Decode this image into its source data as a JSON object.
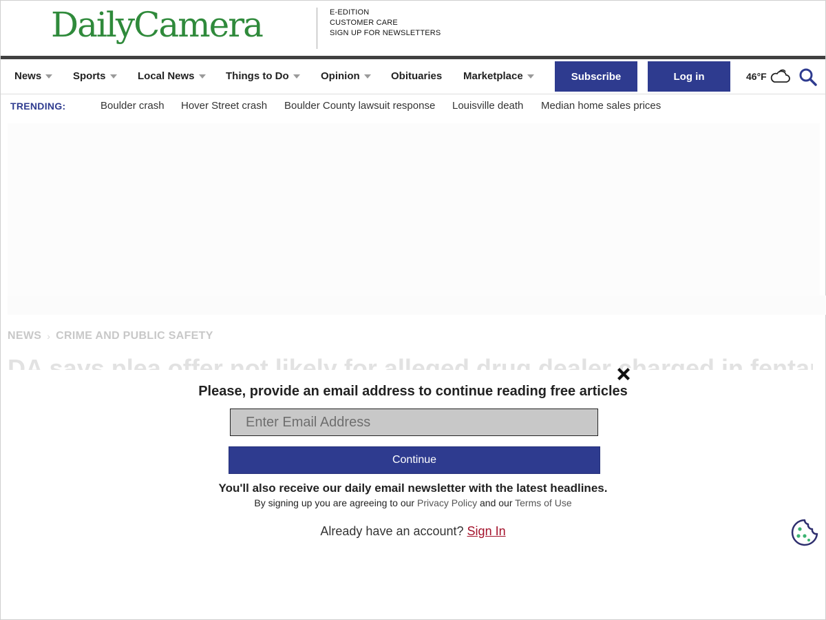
{
  "masthead": {
    "logo": "DailyCamera",
    "links": [
      "E-EDITION",
      "CUSTOMER CARE",
      "SIGN UP FOR NEWSLETTERS"
    ]
  },
  "nav": {
    "items": [
      {
        "label": "News"
      },
      {
        "label": "Sports"
      },
      {
        "label": "Local News"
      },
      {
        "label": "Things to Do"
      },
      {
        "label": "Opinion"
      },
      {
        "label": "Obituaries"
      },
      {
        "label": "Marketplace"
      }
    ],
    "subscribe": "Subscribe",
    "login": "Log in",
    "weather": "46°F"
  },
  "trending": {
    "label": "TRENDING:",
    "items": [
      "Boulder crash",
      "Hover Street crash",
      "Boulder County lawsuit response",
      "Louisville death",
      "Median home sales prices"
    ]
  },
  "article": {
    "breadcrumb": [
      "NEWS",
      "CRIME AND PUBLIC SAFETY"
    ],
    "headline": "DA says plea offer not likely for alleged drug dealer charged in fentanyl"
  },
  "modal": {
    "title": "Please, provide an email address to continue reading free articles",
    "email_placeholder": "Enter Email Address",
    "continue": "Continue",
    "also": "You'll also receive our daily email newsletter with the latest headlines.",
    "agree_prefix": "By signing up you are agreeing to our ",
    "privacy": "Privacy Policy",
    "agree_mid": " and our ",
    "terms": "Terms of Use",
    "already": "Already have an account? ",
    "signin": "Sign In"
  },
  "colors": {
    "brand_green": "#2f8a3b",
    "nav_blue": "#2e3b8f",
    "signin_red": "#a3122b"
  }
}
